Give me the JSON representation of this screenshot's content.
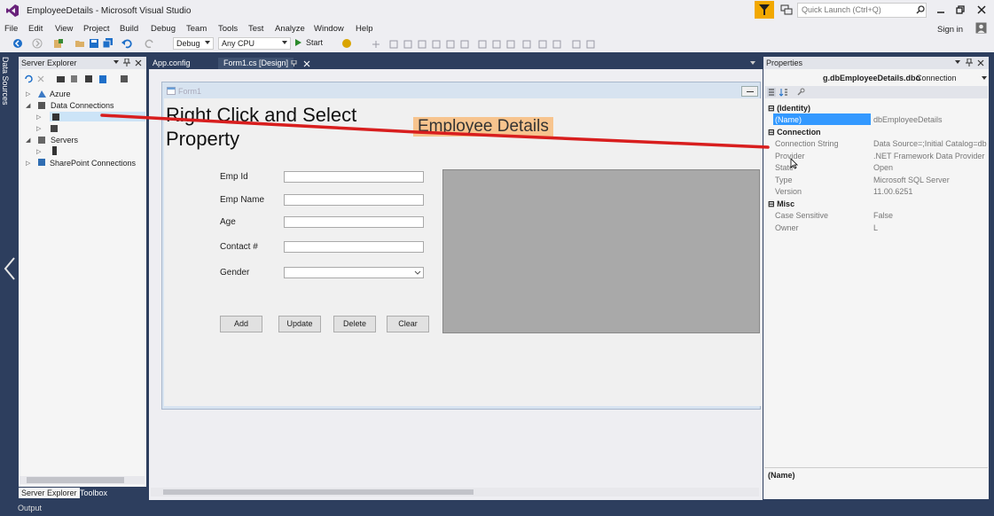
{
  "window": {
    "title": "EmployeeDetails - Microsoft Visual Studio",
    "quick_launch_placeholder": "Quick Launch (Ctrl+Q)",
    "sign_in": "Sign in"
  },
  "menu": [
    "File",
    "Edit",
    "View",
    "Project",
    "Build",
    "Debug",
    "Team",
    "Tools",
    "Test",
    "Analyze",
    "Window",
    "Help"
  ],
  "toolbar": {
    "config": "Debug",
    "platform": "Any CPU",
    "start": "Start"
  },
  "left_strip": {
    "label": "Data Sources"
  },
  "server_explorer": {
    "title": "Server Explorer",
    "nodes": [
      "Azure",
      "Data Connections",
      "Servers",
      "SharePoint Connections"
    ],
    "tabs": [
      "Server Explorer",
      "Toolbox"
    ]
  },
  "doc_tabs": [
    "App.config",
    "Form1.cs [Design]"
  ],
  "form": {
    "title": "Form1",
    "labels": {
      "emp_id": "Emp Id",
      "emp_name": "Emp Name",
      "age": "Age",
      "contact": "Contact #",
      "gender": "Gender"
    },
    "buttons": {
      "add": "Add",
      "update": "Update",
      "delete": "Delete",
      "clear": "Clear"
    }
  },
  "annotation": {
    "line1": "Right Click and Select",
    "line2": "Property",
    "highlight": "Employee Details"
  },
  "properties": {
    "title": "Properties",
    "object_name": "g.dbEmployeeDetails.dbo",
    "object_type": "Connection",
    "categories": {
      "identity": "(Identity)",
      "connection": "Connection",
      "misc": "Misc"
    },
    "rows": [
      {
        "name": "(Name)",
        "value": "dbEmployeeDetails"
      },
      {
        "name": "Connection String",
        "value": "Data Source=;Initial Catalog=db"
      },
      {
        "name": "Provider",
        "value": ".NET Framework Data Provider fo"
      },
      {
        "name": "State",
        "value": "Open"
      },
      {
        "name": "Type",
        "value": "Microsoft SQL Server"
      },
      {
        "name": "Version",
        "value": "11.00.6251"
      },
      {
        "name": "Case Sensitive",
        "value": "False"
      },
      {
        "name": "Owner",
        "value": "L"
      }
    ],
    "description_title": "(Name)"
  },
  "status": {
    "output": "Output"
  }
}
